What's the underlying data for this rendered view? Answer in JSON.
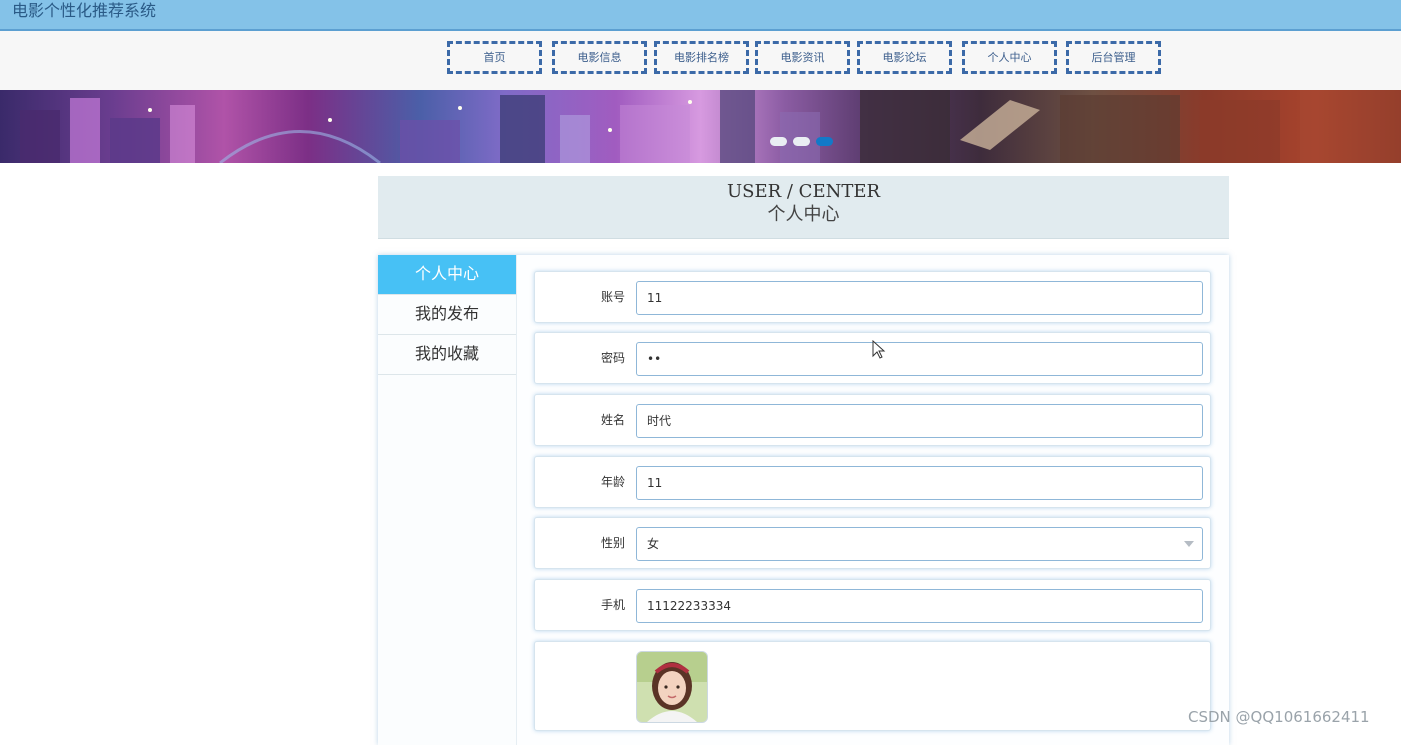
{
  "header": {
    "title": "电影个性化推荐系统"
  },
  "nav": {
    "items": [
      {
        "label": "首页"
      },
      {
        "label": "电影信息"
      },
      {
        "label": "电影排名榜"
      },
      {
        "label": "电影资讯"
      },
      {
        "label": "电影论坛"
      },
      {
        "label": "个人中心"
      },
      {
        "label": "后台管理"
      }
    ]
  },
  "banner": {
    "slide_count": 3,
    "active_slide": 3
  },
  "section": {
    "title_en": "USER / CENTER",
    "title_zh": "个人中心"
  },
  "sidebar": {
    "items": [
      {
        "label": "个人中心",
        "active": true
      },
      {
        "label": "我的发布",
        "active": false
      },
      {
        "label": "我的收藏",
        "active": false
      }
    ]
  },
  "form": {
    "account": {
      "label": "账号",
      "value": "11"
    },
    "password": {
      "label": "密码",
      "value": "••"
    },
    "name": {
      "label": "姓名",
      "value": "时代"
    },
    "age": {
      "label": "年龄",
      "value": "11"
    },
    "gender": {
      "label": "性别",
      "value": "女"
    },
    "phone": {
      "label": "手机",
      "value": "11122233334"
    }
  },
  "watermark": "CSDN @QQ1061662411",
  "colors": {
    "topbar": "#84c2e8",
    "nav_border": "#3c6aa8",
    "sidebar_active": "#47c1f5",
    "dot_active": "#1279c8",
    "field_border": "#8fb7d8"
  }
}
